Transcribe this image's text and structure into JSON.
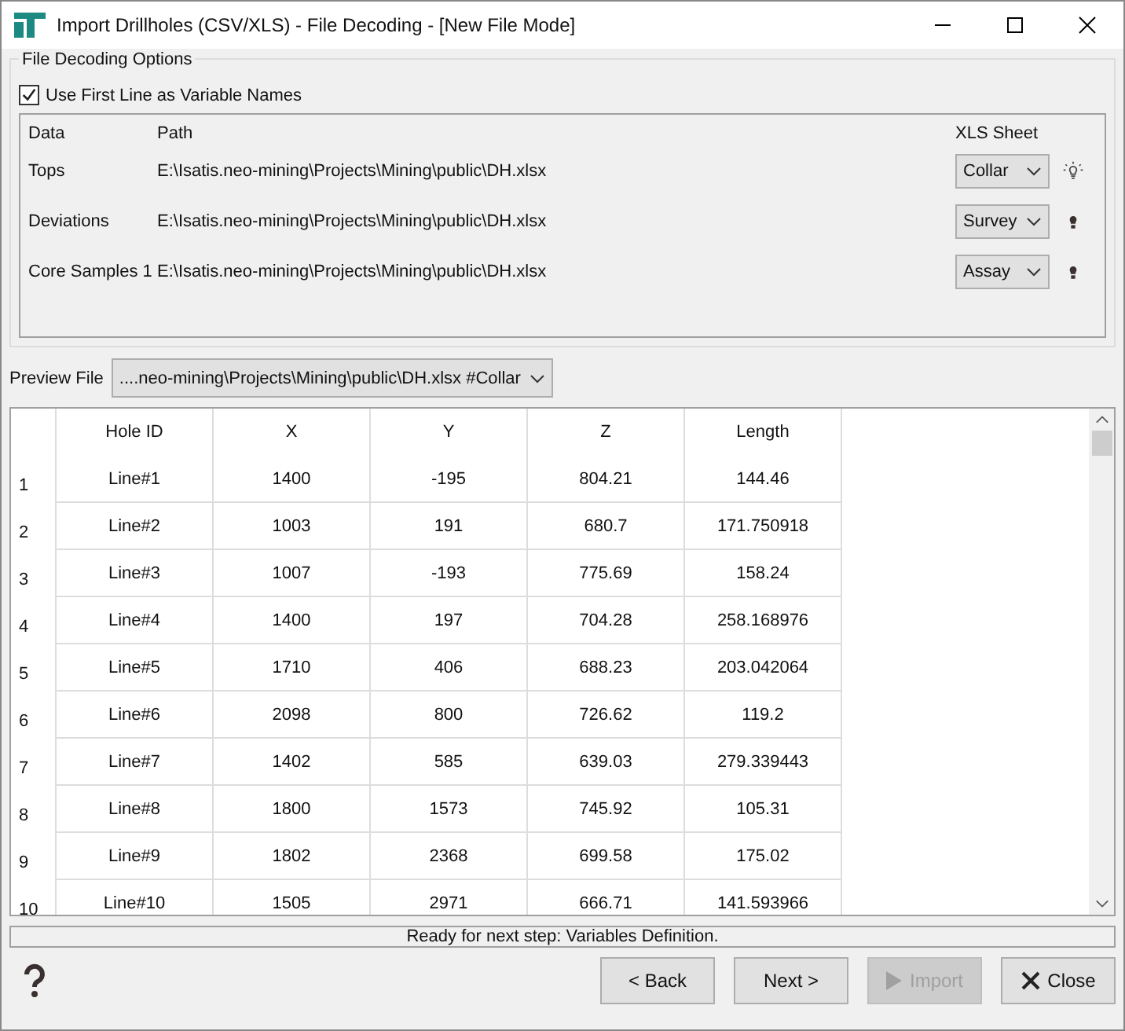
{
  "window": {
    "title": "Import Drillholes (CSV/XLS) - File Decoding - [New File Mode]"
  },
  "options": {
    "title": "File Decoding Options",
    "use_first_line": {
      "label": "Use First Line as Variable Names",
      "checked": true
    },
    "columns": [
      "Data",
      "Path",
      "XLS Sheet"
    ],
    "files": [
      {
        "data": "Tops",
        "path": "E:\\Isatis.neo-mining\\Projects\\Mining\\public\\DH.xlsx",
        "sheet": "Collar",
        "highlighted": true
      },
      {
        "data": "Deviations",
        "path": "E:\\Isatis.neo-mining\\Projects\\Mining\\public\\DH.xlsx",
        "sheet": "Survey",
        "highlighted": false
      },
      {
        "data": "Core Samples 1",
        "path": "E:\\Isatis.neo-mining\\Projects\\Mining\\public\\DH.xlsx",
        "sheet": "Assay",
        "highlighted": false
      }
    ]
  },
  "preview": {
    "label": "Preview File",
    "value": "....neo-mining\\Projects\\Mining\\public\\DH.xlsx #Collar"
  },
  "table": {
    "columns": [
      "Hole ID",
      "X",
      "Y",
      "Z",
      "Length"
    ],
    "rows": [
      {
        "index": "1",
        "cells": [
          "Line#1",
          "1400",
          "-195",
          "804.21",
          "144.46"
        ]
      },
      {
        "index": "2",
        "cells": [
          "Line#2",
          "1003",
          "191",
          "680.7",
          "171.750918"
        ]
      },
      {
        "index": "3",
        "cells": [
          "Line#3",
          "1007",
          "-193",
          "775.69",
          "158.24"
        ]
      },
      {
        "index": "4",
        "cells": [
          "Line#4",
          "1400",
          "197",
          "704.28",
          "258.168976"
        ]
      },
      {
        "index": "5",
        "cells": [
          "Line#5",
          "1710",
          "406",
          "688.23",
          "203.042064"
        ]
      },
      {
        "index": "6",
        "cells": [
          "Line#6",
          "2098",
          "800",
          "726.62",
          "119.2"
        ]
      },
      {
        "index": "7",
        "cells": [
          "Line#7",
          "1402",
          "585",
          "639.03",
          "279.339443"
        ]
      },
      {
        "index": "8",
        "cells": [
          "Line#8",
          "1800",
          "1573",
          "745.92",
          "105.31"
        ]
      },
      {
        "index": "9",
        "cells": [
          "Line#9",
          "1802",
          "2368",
          "699.58",
          "175.02"
        ]
      },
      {
        "index": "10",
        "cells": [
          "Line#10",
          "1505",
          "2971",
          "666.71",
          "141.593966"
        ]
      }
    ]
  },
  "status_bar": "Ready for next step: Variables Definition.",
  "buttons": [
    {
      "label": "< Back",
      "kind": "plain",
      "disabled": false
    },
    {
      "label": "Next >",
      "kind": "plain",
      "disabled": false
    },
    {
      "label": "Import",
      "kind": "import",
      "disabled": true
    },
    {
      "label": "Close",
      "kind": "close",
      "disabled": false
    }
  ]
}
